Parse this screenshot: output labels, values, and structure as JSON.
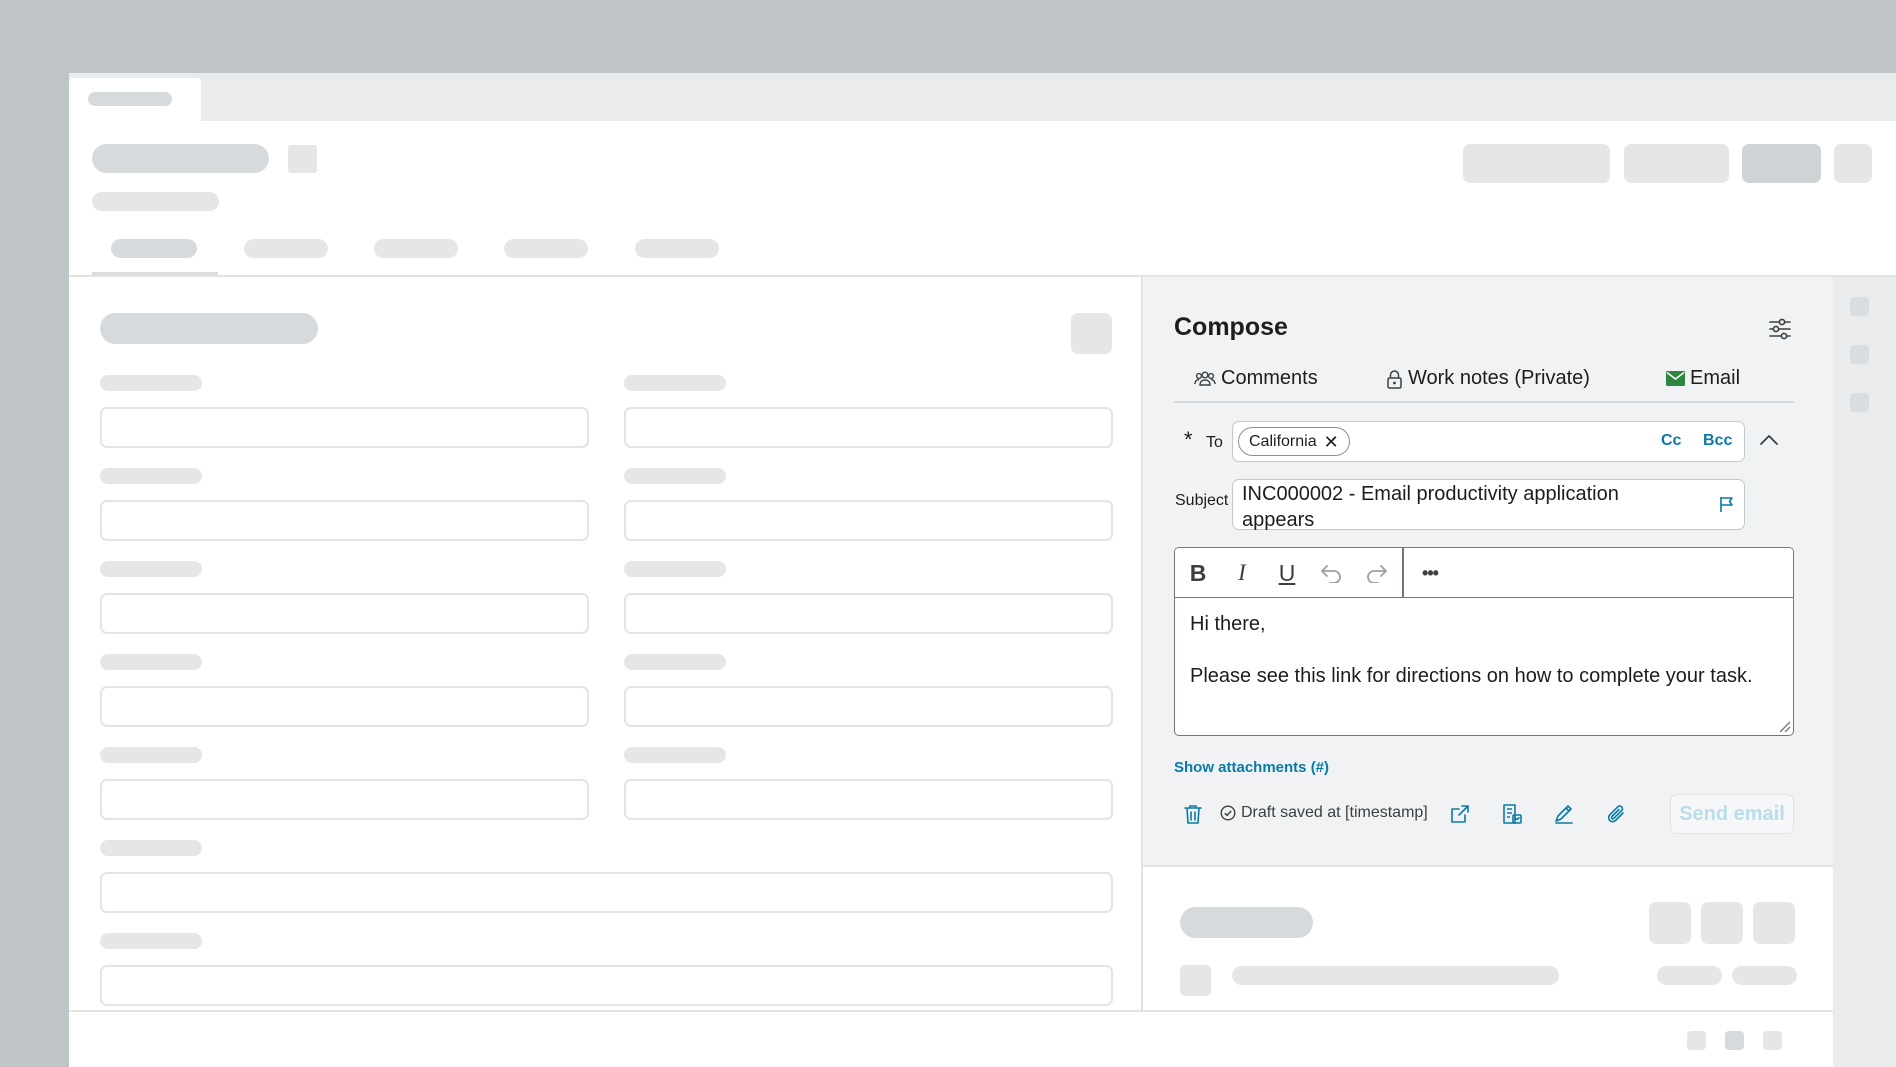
{
  "compose": {
    "title": "Compose",
    "tabs": [
      {
        "label": "Comments",
        "icon": "people-icon"
      },
      {
        "label": "Work notes (Private)",
        "icon": "lock-icon"
      },
      {
        "label": "Email",
        "icon": "envelope-icon",
        "active": true
      }
    ],
    "to": {
      "required_mark": "*",
      "label": "To",
      "recipients": [
        "California"
      ],
      "cc_label": "Cc",
      "bcc_label": "Bcc"
    },
    "subject": {
      "label": "Subject",
      "value": "INC000002 - Email productivity application appears"
    },
    "toolbar": {
      "bold": "B",
      "italic": "I",
      "underline": "U",
      "more": "•••"
    },
    "body": {
      "greeting": "Hi there,",
      "message": "Please see this link for directions on how to complete your task."
    },
    "show_attachments": "Show attachments (#)",
    "draft_status": "Draft saved at [timestamp]",
    "send_label": "Send email"
  },
  "colors": {
    "accent": "#0a7aa6",
    "email_icon": "#2e8540",
    "send_disabled": "#b9dde9",
    "backdrop": "#bec4c7"
  }
}
